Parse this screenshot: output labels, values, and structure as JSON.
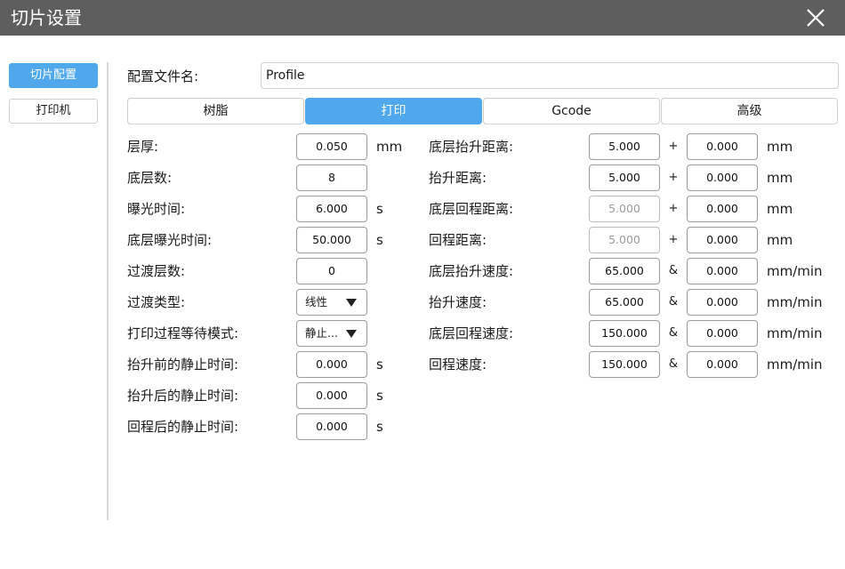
{
  "window": {
    "title": "切片设置"
  },
  "sidebar": {
    "items": [
      {
        "label": "切片配置"
      },
      {
        "label": "打印机"
      }
    ]
  },
  "profile": {
    "label": "配置文件名:",
    "value": "Profile"
  },
  "tabs": [
    {
      "label": "树脂"
    },
    {
      "label": "打印"
    },
    {
      "label": "Gcode"
    },
    {
      "label": "高级"
    }
  ],
  "left_params": [
    {
      "label": "层厚:",
      "value": "0.050",
      "unit": "mm"
    },
    {
      "label": "底层数:",
      "value": "8",
      "unit": ""
    },
    {
      "label": "曝光时间:",
      "value": "6.000",
      "unit": "s"
    },
    {
      "label": "底层曝光时间:",
      "value": "50.000",
      "unit": "s"
    },
    {
      "label": "过渡层数:",
      "value": "0",
      "unit": ""
    },
    {
      "label": "过渡类型:",
      "value": "线性",
      "unit": ""
    },
    {
      "label": "打印过程等待模式:",
      "value": "静止...",
      "unit": ""
    },
    {
      "label": "抬升前的静止时间:",
      "value": "0.000",
      "unit": "s"
    },
    {
      "label": "抬升后的静止时间:",
      "value": "0.000",
      "unit": "s"
    },
    {
      "label": "回程后的静止时间:",
      "value": "0.000",
      "unit": "s"
    }
  ],
  "right_params": [
    {
      "label": "底层抬升距离:",
      "value1": "5.000",
      "op": "+",
      "value2": "0.000",
      "unit": "mm"
    },
    {
      "label": "抬升距离:",
      "value1": "5.000",
      "op": "+",
      "value2": "0.000",
      "unit": "mm"
    },
    {
      "label": "底层回程距离:",
      "value1": "5.000",
      "op": "+",
      "value2": "0.000",
      "unit": "mm"
    },
    {
      "label": "回程距离:",
      "value1": "5.000",
      "op": "+",
      "value2": "0.000",
      "unit": "mm"
    },
    {
      "label": "底层抬升速度:",
      "value1": "65.000",
      "op": "&",
      "value2": "0.000",
      "unit": "mm/min"
    },
    {
      "label": "抬升速度:",
      "value1": "65.000",
      "op": "&",
      "value2": "0.000",
      "unit": "mm/min"
    },
    {
      "label": "底层回程速度:",
      "value1": "150.000",
      "op": "&",
      "value2": "0.000",
      "unit": "mm/min"
    },
    {
      "label": "回程速度:",
      "value1": "150.000",
      "op": "&",
      "value2": "0.000",
      "unit": "mm/min"
    }
  ],
  "colors": {
    "titlebar": "#5e5e5e",
    "accent": "#4fa8ec"
  }
}
